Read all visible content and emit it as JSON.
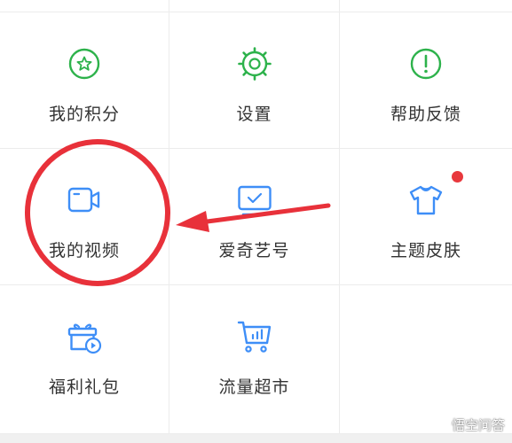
{
  "menu": {
    "items": [
      {
        "label": "我的积分",
        "icon": "star-coin-icon"
      },
      {
        "label": "设置",
        "icon": "gear-icon"
      },
      {
        "label": "帮助反馈",
        "icon": "info-exclamation-icon"
      },
      {
        "label": "我的视频",
        "icon": "video-camera-icon"
      },
      {
        "label": "爱奇艺号",
        "icon": "checked-screen-icon"
      },
      {
        "label": "主题皮肤",
        "icon": "tshirt-icon"
      },
      {
        "label": "福利礼包",
        "icon": "gift-play-icon"
      },
      {
        "label": "流量超市",
        "icon": "shopping-cart-icon"
      }
    ]
  },
  "colors": {
    "green": "#2db24b",
    "blue": "#3e8ef7",
    "annotation_red": "#e8313a",
    "badge_red": "#e8383d"
  },
  "watermark": {
    "text": "悟空问答"
  }
}
